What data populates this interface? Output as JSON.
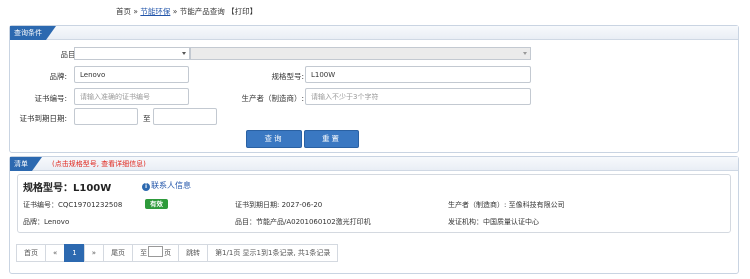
{
  "breadcrumb": {
    "home": "首页",
    "sep": "»",
    "section": "节能环保",
    "page": "节能产品查询",
    "print": "【打印】"
  },
  "query": {
    "title": "查询条件",
    "category_label": "品目:",
    "brand_label": "品牌:",
    "brand_value": "Lenovo",
    "model_label": "规格型号:",
    "model_value": "L100W",
    "cert_label": "证书编号:",
    "cert_placeholder": "请输入准确的证书编号",
    "maker_label": "生产者（制造商）:",
    "maker_placeholder": "请输入不少于3个字符",
    "expiry_label": "证书到期日期:",
    "to_label": "至",
    "search_button": "查询",
    "reset_button": "重置"
  },
  "list": {
    "title": "清单",
    "note": "(点击规格型号, 查看详细信息)",
    "item": {
      "model": "规格型号：L100W",
      "contact": "联系人信息",
      "cert_no": "证书编号：CQC19701232508",
      "status": "有效",
      "expiry": "证书到期日期: 2027-06-20",
      "maker": "生产者（制造商）: 至像科技有限公司",
      "brand": "品牌：Lenovo",
      "category": "品目：节能产品/A0201060102激光打印机",
      "issuer": "发证机构：中国质量认证中心"
    }
  },
  "pager": {
    "first": "首页",
    "prev": "«",
    "current": "1",
    "next": "»",
    "last": "尾页",
    "to": "至",
    "page": "页",
    "jump": "跳转",
    "summary": "第1/1页 显示1到1条记录, 共1条记录"
  },
  "colors": {
    "accent": "#2c69b0",
    "valid": "#2e9a3b",
    "note": "#e0271d"
  }
}
